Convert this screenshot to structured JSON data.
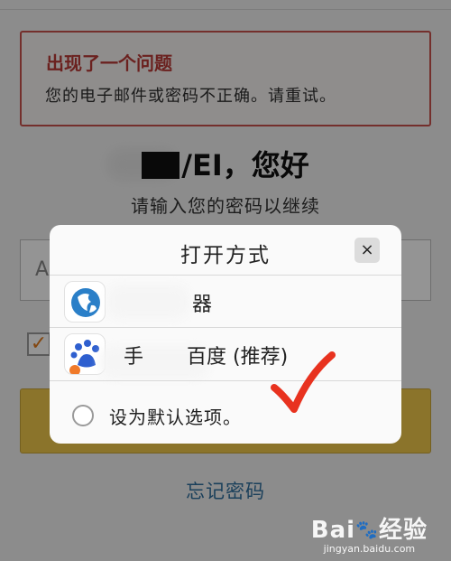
{
  "error": {
    "title": "出现了一个问题",
    "message": "您的电子邮件或密码不正确。请重试。"
  },
  "greeting": {
    "name_suffix": "/EI，您好"
  },
  "prompt": "请输入您的密码以继续",
  "password_field": {
    "visible_text": "A"
  },
  "forgot_password": "忘记密码",
  "dialog": {
    "title": "打开方式",
    "close_glyph": "×",
    "apps": [
      {
        "label_visible": "器",
        "icon": "browser-globe-icon"
      },
      {
        "label_visible_1": "手",
        "label_visible_2": "百度 (推荐)",
        "icon": "baidu-paw-icon"
      }
    ],
    "default_option": "设为默认选项。"
  },
  "watermark": {
    "logo_text_1": "Bai",
    "logo_text_2": "经验",
    "site": "jingyan.baidu.com"
  },
  "colors": {
    "error_border": "#c9524d",
    "error_title": "#b83a36",
    "button_yellow": "#f0c84b",
    "link_blue": "#2f6f9e",
    "annotation_red": "#e8321f"
  }
}
